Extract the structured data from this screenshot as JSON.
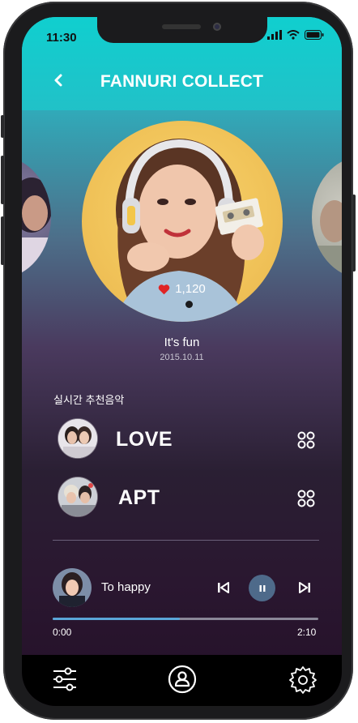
{
  "status_bar": {
    "time": "11:30"
  },
  "header": {
    "title": "FANNURI COLLECT"
  },
  "featured": {
    "likes": "1,120",
    "song_title": "It's fun",
    "release_date": "2015.10.11"
  },
  "recommend": {
    "label": "실시간 추천음악",
    "tracks": [
      {
        "title": "LOVE"
      },
      {
        "title": "APT"
      }
    ]
  },
  "player": {
    "title": "To happy",
    "elapsed": "0:00",
    "duration": "2:10",
    "progress": 0.48
  },
  "colors": {
    "accent": "#19c9c9",
    "heart": "#e02424",
    "progress": "#5aa6d8"
  }
}
